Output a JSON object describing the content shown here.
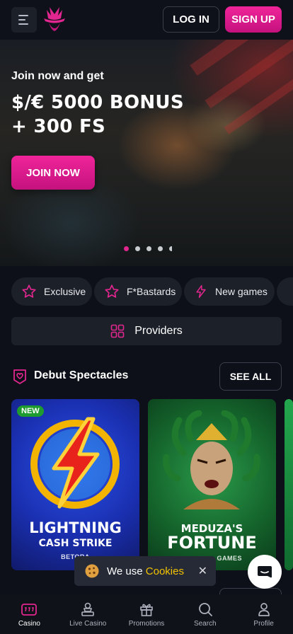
{
  "header": {
    "login_label": "LOG IN",
    "signup_label": "SIGN UP"
  },
  "hero": {
    "subtitle": "Join now and get",
    "title_line1": "$/€ 5000 BONUS",
    "title_line2": "+ 300 FS",
    "cta_label": "JOIN NOW",
    "carousel": {
      "active_index": 0
    }
  },
  "categories": [
    {
      "label": "Exclusive",
      "icon": "star-icon"
    },
    {
      "label": "F*Bastards",
      "icon": "star-icon"
    },
    {
      "label": "New games",
      "icon": "lightning-icon"
    }
  ],
  "providers": {
    "label": "Providers",
    "icon": "grid-icon"
  },
  "section": {
    "title": "Debut Spectacles",
    "see_all_label": "SEE ALL"
  },
  "games": [
    {
      "badge": "NEW",
      "title_line1": "LIGHTNING",
      "title_line2": "CASH STRIKE",
      "provider": "BETORA"
    },
    {
      "title_line1": "MEDUZA'S",
      "title_line2": "FORTUNE",
      "provider": "GAMES"
    }
  ],
  "cookie": {
    "text": "We use",
    "link": "Cookies",
    "close": "✕"
  },
  "bottom_nav": [
    {
      "label": "Casino",
      "icon": "slot-machine-icon",
      "active": true
    },
    {
      "label": "Live Casino",
      "icon": "dealer-icon",
      "active": false
    },
    {
      "label": "Promotions",
      "icon": "gift-icon",
      "active": false
    },
    {
      "label": "Search",
      "icon": "search-icon",
      "active": false
    },
    {
      "label": "Profile",
      "icon": "user-icon",
      "active": false
    }
  ],
  "colors": {
    "accent": "#e2268f",
    "background": "#0d1018",
    "surface": "#1c2029",
    "cookie_link": "#f2c200",
    "new_badge": "#1e9b2e"
  }
}
